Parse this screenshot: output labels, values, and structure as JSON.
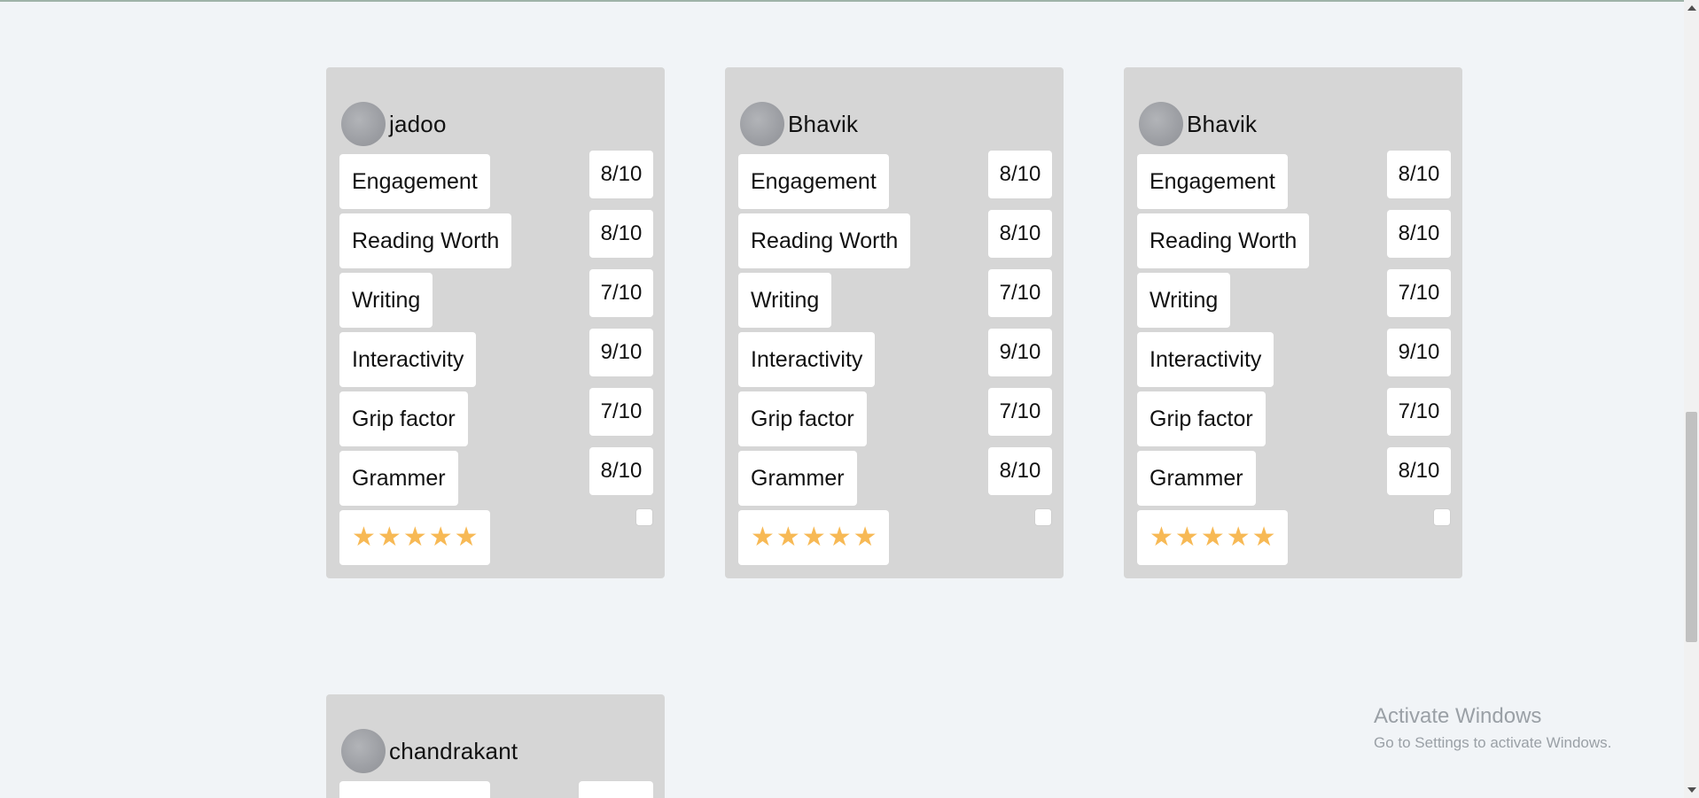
{
  "cards": [
    {
      "name": "jadoo",
      "metrics": [
        {
          "label": "Engagement",
          "score": "8/10"
        },
        {
          "label": "Reading Worth",
          "score": "8/10"
        },
        {
          "label": "Writing",
          "score": "7/10"
        },
        {
          "label": "Interactivity",
          "score": "9/10"
        },
        {
          "label": "Grip factor",
          "score": "7/10"
        },
        {
          "label": "Grammer",
          "score": "8/10"
        }
      ],
      "stars": 5
    },
    {
      "name": "Bhavik",
      "metrics": [
        {
          "label": "Engagement",
          "score": "8/10"
        },
        {
          "label": "Reading Worth",
          "score": "8/10"
        },
        {
          "label": "Writing",
          "score": "7/10"
        },
        {
          "label": "Interactivity",
          "score": "9/10"
        },
        {
          "label": "Grip factor",
          "score": "7/10"
        },
        {
          "label": "Grammer",
          "score": "8/10"
        }
      ],
      "stars": 5
    },
    {
      "name": "Bhavik",
      "metrics": [
        {
          "label": "Engagement",
          "score": "8/10"
        },
        {
          "label": "Reading Worth",
          "score": "8/10"
        },
        {
          "label": "Writing",
          "score": "7/10"
        },
        {
          "label": "Interactivity",
          "score": "9/10"
        },
        {
          "label": "Grip factor",
          "score": "7/10"
        },
        {
          "label": "Grammer",
          "score": "8/10"
        }
      ],
      "stars": 5
    },
    {
      "name": "chandrakant",
      "metrics": [],
      "stars": 0
    }
  ],
  "watermark": {
    "title": "Activate Windows",
    "subtitle": "Go to Settings to activate Windows."
  },
  "icons": {
    "star": "star-icon",
    "avatar": "avatar"
  },
  "colors": {
    "page_bg": "#f1f4f7",
    "card_bg": "#d6d6d6",
    "star": "#f7b955"
  }
}
